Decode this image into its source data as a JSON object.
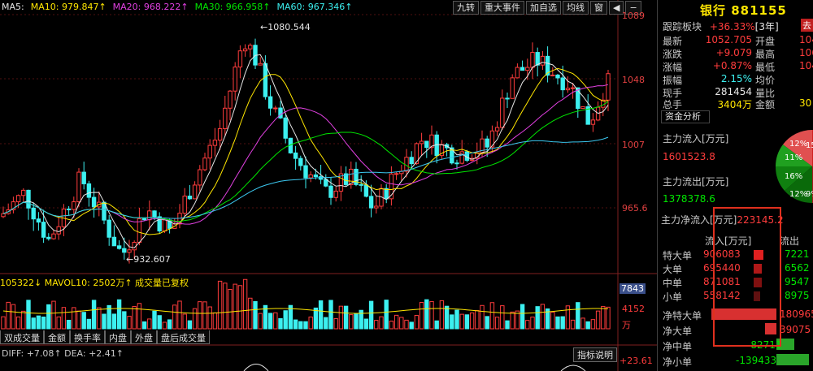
{
  "chart": {
    "ma_legend": {
      "ma5": "MA5:",
      "ma10": "MA10: 979.847↑",
      "ma20": "MA20: 968.222↑",
      "ma30": "MA30: 966.958↑",
      "ma60": "MA60: 967.346↑"
    },
    "toolbar": [
      "九转",
      "重大事件",
      "加自选",
      "均线",
      "窗"
    ],
    "price_axis": [
      "1089",
      "1048",
      "1007",
      "965.6"
    ],
    "annotations": {
      "high": "1080.544",
      "low": "932.607"
    },
    "volume": {
      "legend": "105322↓ MAVOL10: 2502万↑ 成交量已复权",
      "axis": [
        "7843",
        "4152",
        "万"
      ]
    },
    "tabs": [
      "双成交量",
      "金额",
      "换手率",
      "内盘",
      "外盘",
      "盘后成交量"
    ],
    "macd": {
      "legend": "DIFF: +7.08↑ DEA: +2.41↑",
      "button": "指标说明",
      "axis": "+23.61"
    }
  },
  "panel": {
    "title": "银行 881155",
    "track_label": "跟踪板块",
    "track_value": "+36.33%",
    "track_period": "[3年]",
    "quote": {
      "latest": {
        "label": "最新",
        "value": "1052.705"
      },
      "change": {
        "label": "涨跌",
        "value": "+9.079"
      },
      "pct": {
        "label": "涨幅",
        "value": "+0.87%"
      },
      "amplitude": {
        "label": "振幅",
        "value": "2.15%"
      },
      "current": {
        "label": "现手",
        "value": "281454"
      },
      "total": {
        "label": "总手",
        "value": "3404万"
      },
      "open_label": "开盘",
      "high_label": "最高",
      "low_label": "最低",
      "avg_label": "均价",
      "ratio_label": "量比",
      "amount_label": "金额",
      "open_value": "104",
      "high_value": "106",
      "low_value": "104",
      "amount_value": "30"
    },
    "capital": {
      "section": "资金分析",
      "inflow_label": "主力流入[万元]",
      "inflow_value": "1601523.8",
      "outflow_label": "主力流出[万元]",
      "outflow_value": "1378378.6",
      "net_label": "主力净流入[万元]",
      "net_value": "223145.2",
      "pie_labels": [
        "15%",
        "12%",
        "11%",
        "16%",
        "12%",
        "9%"
      ],
      "in_header": "流入[万元]",
      "out_header": "流出",
      "rows": [
        {
          "label": "特大单",
          "in": "906083",
          "out": "7221"
        },
        {
          "label": "大单",
          "in": "695440",
          "out": "6562"
        },
        {
          "label": "中单",
          "in": "871081",
          "out": "9547"
        },
        {
          "label": "小单",
          "in": "558142",
          "out": "8975"
        }
      ],
      "net_rows": [
        {
          "label": "净特大单",
          "value": "180965"
        },
        {
          "label": "净大单",
          "value": "39075"
        },
        {
          "label": "净中单",
          "value": "-82711"
        },
        {
          "label": "净小单",
          "value": "-139433"
        }
      ]
    }
  },
  "colors": {
    "up": "#ff3c3c",
    "down": "#3cf0f0",
    "title": "#ffe600",
    "highlight_box": "#e0301e"
  }
}
